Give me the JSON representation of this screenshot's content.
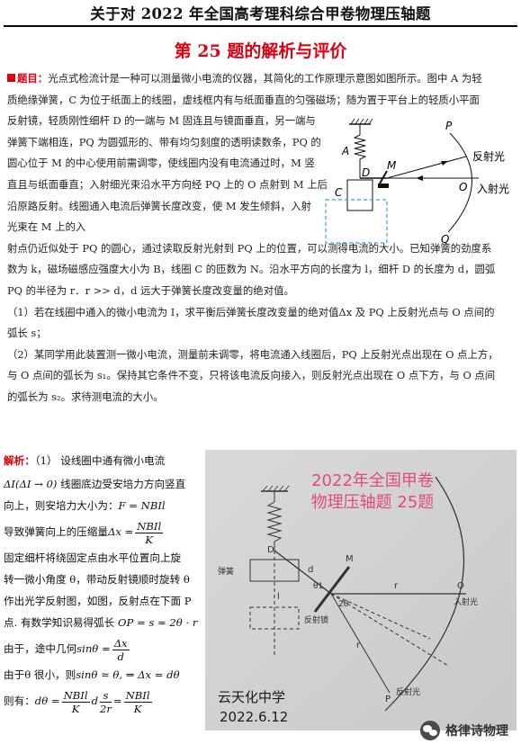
{
  "header": {
    "title": "关于对 2022 年全国高考理科综合甲卷物理压轴题"
  },
  "subtitle": "第 25 题的解析与评价",
  "problem": {
    "tag": "题目：",
    "lines": [
      "光点式检流计是一种可以测量微小电流的仪器，其简化的工作原理示意图如图所示。图中 A 为轻",
      "质绝缘弹簧，C 为位于纸面上的线圈，虚线框内有与纸面垂直的匀强磁场；随为置于平台上的轻质小平面",
      "反射镜，轻质刚性细杆 D 的一端与 M 固连且与镜面垂直，另一端与",
      "弹簧下端相连，PQ 为圆弧形的、带有均匀刻度的透明读数条，PQ 的",
      "圆心位于 M 的中心使用前需调零，使线圈内没有电流通过时，M 竖",
      "直且与纸面垂直；入射细光束沿水平方向经 PQ 上的 O 点射到 M 上后",
      "沿原路反射。线圈通入电流后弹簧长度改变，使 M 发生倾斜，入射",
      "光束在 M 上的入",
      "射点仍近似处于 PQ 的圆心，通过读取反射光射到 PQ 上的位置，可以测得电流的大小。已知弹簧的劲度系",
      "数为 k，磁场磁感应强度大小为 B，线圈 C 的匝数为 N。沿水平方向的长度为 l，细杆 D 的长度为 d，圆弧",
      "PQ 的半径为 r．r >> d，d 远大于弹簧长度改变量的绝对值。"
    ],
    "q1": [
      "（1）若在线圈中通入的微小电流为 I，求平衡后弹簧长度改变量的绝对值Δx 及 PQ 上反射光点与 O 点间的",
      "弧长 s；"
    ],
    "q2": [
      "（2）某同学用此装置测一微小电流，测量前未调零，将电流通入线圈后，PQ 上反射光点出现在 O 点上方，",
      "与 O 点间的弧长为 s₁。保持其它条件不变，只将该电流反向接入，则反射光点出现在 O 点下方，与 O 点间",
      "的弧长为 s₂。求待测电流的大小。"
    ]
  },
  "figure": {
    "labels": {
      "P": "P",
      "Q": "Q",
      "A": "A",
      "C": "C",
      "D": "D",
      "M": "M",
      "O": "O"
    },
    "reflected": "反射光",
    "incident": "入射光"
  },
  "solution": {
    "tag": "解析：",
    "l1": "（1） 设线圈中通有微小电流",
    "l2a": "ΔI(ΔI → 0)",
    "l2b": " 线圈底边受安培力方向竖直",
    "l3": "向上，则安培力大小为：",
    "l3eq": "F = NBIl",
    "l4": "导致弹簧向上的压缩量",
    "l4a": "Δx =",
    "l4n": "NBIl",
    "l4d": "K",
    "l5": "固定细杆将绕固定点由水平位置向上旋",
    "l6": "转一微小角度 θ，带动反射镜顺时旋转 θ",
    "l7": "作出光学反射图，如图，反射点在下面 P",
    "l8a": "点. 有数学知识易得弧长",
    "l8b": "OP = s = 2θ · r",
    "l9a": "由于，途中几何",
    "l9b": "sinθ =",
    "l9n": "Δx",
    "l9d": "d",
    "l10a": "由于θ 很小，则",
    "l10b": "sinθ ≈ θ, ⇒ Δx = dθ",
    "l11a": "则有：",
    "l11b": "dθ =",
    "l11n": "NBIl",
    "l11d": "K",
    "l11c": "d",
    "l11sn": "s",
    "l11sd": "2r",
    "l11e": "="
  },
  "photo": {
    "title1": "2022年全国甲卷",
    "title2": "物理压轴题 25题",
    "sign1": "云天化中学",
    "sign2": "2022.6.12",
    "hw_labels": [
      "M",
      "D",
      "l",
      "弹簧",
      "θ1",
      "2θ",
      "r",
      "O",
      "入射光",
      "反射镜",
      "P",
      "d",
      "反射光"
    ]
  },
  "watermark": "格律诗物理"
}
